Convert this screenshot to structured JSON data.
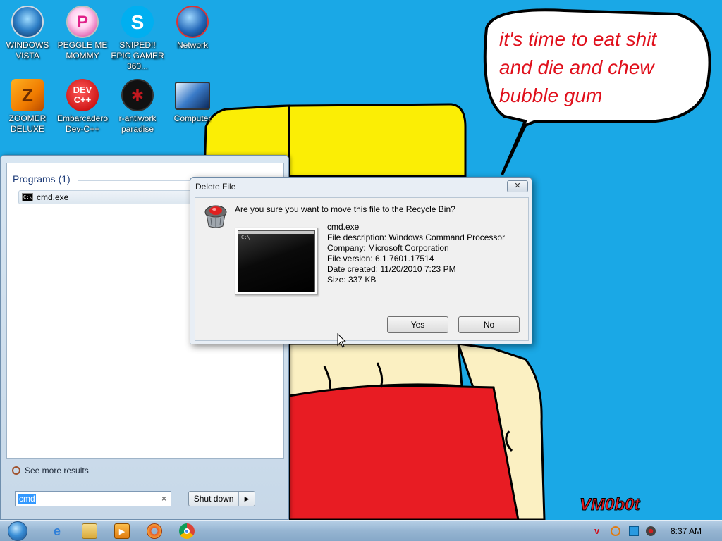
{
  "desktop": {
    "icons": [
      {
        "label": "WINDOWS VISTA"
      },
      {
        "label": "PEGGLE ME MOMMY"
      },
      {
        "label": "SNIPED!! EPIC GAMER 360..."
      },
      {
        "label": "Network"
      },
      {
        "label": "ZOOMER DELUXE"
      },
      {
        "label": "Embarcadero Dev-C++"
      },
      {
        "label": "r-antiwork paradise"
      },
      {
        "label": "Computer"
      }
    ],
    "speech_text": "it's time to eat shit and die and chew bubble gum",
    "speech_lines": [
      "it's time to eat shit",
      "and die and chew",
      "bubble gum"
    ],
    "signature": "VM0b0t"
  },
  "start_menu": {
    "programs_heading": "Programs (1)",
    "results": [
      {
        "label": "cmd.exe"
      }
    ],
    "see_more": "See more results",
    "search_value": "cmd",
    "search_clear": "×",
    "shutdown_label": "Shut down",
    "shutdown_arrow": "▶"
  },
  "dialog": {
    "title": "Delete File",
    "close_glyph": "✕",
    "question": "Are you sure you want to move this file to the Recycle Bin?",
    "thumbnail_prompt": "C:\\_",
    "file_info": [
      "cmd.exe",
      "File description: Windows Command Processor",
      "Company: Microsoft Corporation",
      "File version: 6.1.7601.17514",
      "Date created: 11/20/2010 7:23 PM",
      "Size: 337 KB"
    ],
    "buttons": {
      "yes": "Yes",
      "no": "No"
    }
  },
  "taskbar": {
    "pinned": [
      {
        "name": "internet-explorer-icon",
        "color": "#2f7fd8"
      },
      {
        "name": "file-explorer-icon",
        "color": "#e9c35a"
      },
      {
        "name": "media-player-icon",
        "color": "#f39a1c"
      },
      {
        "name": "paint-icon",
        "color": "#e65a2a"
      },
      {
        "name": "chrome-icon",
        "color": "#db4437"
      }
    ],
    "clock": "8:37 AM"
  },
  "colors": {
    "desktop_bg": "#1aa8e6",
    "hair_yellow": "#fbee05",
    "shirt_red": "#e81c23",
    "skin": "#fbf0c2",
    "speech_text": "#e0101c"
  }
}
